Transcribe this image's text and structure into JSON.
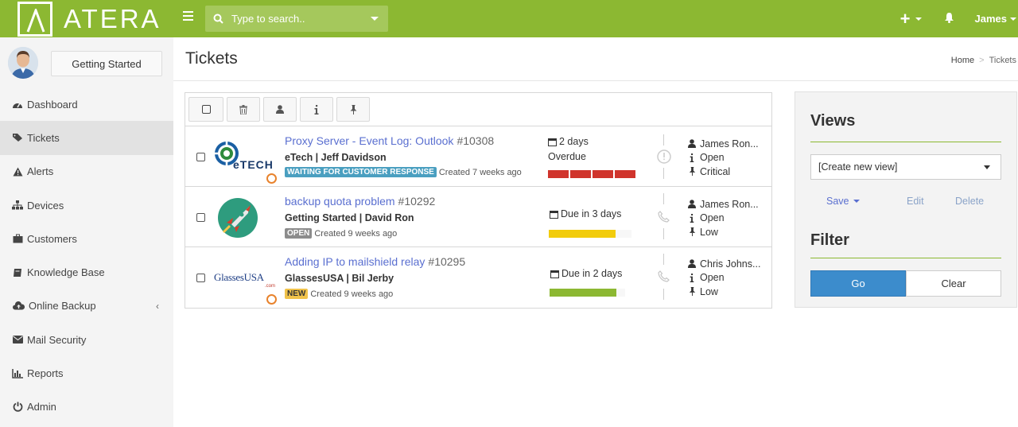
{
  "app": {
    "logo_text": "ATERA"
  },
  "topbar": {
    "search_placeholder": "Type to search..",
    "user_name": "James"
  },
  "sidebar": {
    "getting_started": "Getting Started",
    "items": [
      {
        "label": "Dashboard",
        "icon": "dashboard-icon"
      },
      {
        "label": "Tickets",
        "icon": "tag-icon",
        "active": true
      },
      {
        "label": "Alerts",
        "icon": "warning-icon"
      },
      {
        "label": "Devices",
        "icon": "sitemap-icon"
      },
      {
        "label": "Customers",
        "icon": "briefcase-icon"
      },
      {
        "label": "Knowledge Base",
        "icon": "book-icon"
      },
      {
        "label": "Online Backup",
        "icon": "cloud-upload-icon"
      },
      {
        "label": "Mail Security",
        "icon": "envelope-icon"
      },
      {
        "label": "Reports",
        "icon": "bar-chart-icon"
      },
      {
        "label": "Admin",
        "icon": "power-icon"
      }
    ]
  },
  "page": {
    "title": "Tickets",
    "breadcrumb": [
      "Home",
      "Tickets"
    ]
  },
  "tickets": [
    {
      "title": "Proxy Server - Event Log: Outlook",
      "number": "#10308",
      "subtitle": "eTech | Jeff Davidson",
      "badge": "WAITING FOR CUSTOMER RESPONSE",
      "badge_color": "#4a9fc0",
      "created": "Created 7 weeks ago",
      "due_line1": "2 days",
      "due_line2": "Overdue",
      "bar_color": "#d0342c",
      "bar_fill": 1.0,
      "assignee": "James Ron...",
      "status": "Open",
      "priority": "Critical"
    },
    {
      "title": "backup quota problem",
      "number": "#10292",
      "subtitle": "Getting Started | David Ron",
      "badge": "OPEN",
      "badge_color": "#8c8c8c",
      "created": "Created 9 weeks ago",
      "due_line1": "Due in 3 days",
      "bar_color": "#f2cc0c",
      "bar_fill": 0.75,
      "assignee": "James Ron...",
      "status": "Open",
      "priority": "Low"
    },
    {
      "title": "Adding IP to mailshield relay",
      "number": "#10295",
      "subtitle": "GlassesUSA | Bil Jerby",
      "badge": "NEW",
      "badge_color": "#f0b429",
      "created": "Created 9 weeks ago",
      "due_line1": "Due in 2 days",
      "bar_color": "#8cb832",
      "bar_fill": 0.75,
      "assignee": "Chris Johns...",
      "status": "Open",
      "priority": "Low"
    }
  ],
  "logos": {
    "etech_text": "eTECH",
    "glasses_text": "GlassesUSA",
    "glasses_small": ".com"
  },
  "views_panel": {
    "views_title": "Views",
    "select_value": "[Create new view]",
    "save": "Save",
    "edit": "Edit",
    "delete": "Delete",
    "filter_title": "Filter",
    "go": "Go",
    "clear": "Clear"
  },
  "colors": {
    "brand": "#8cb832",
    "link": "#5a6fd0",
    "primary_button": "#3c8ccc"
  }
}
